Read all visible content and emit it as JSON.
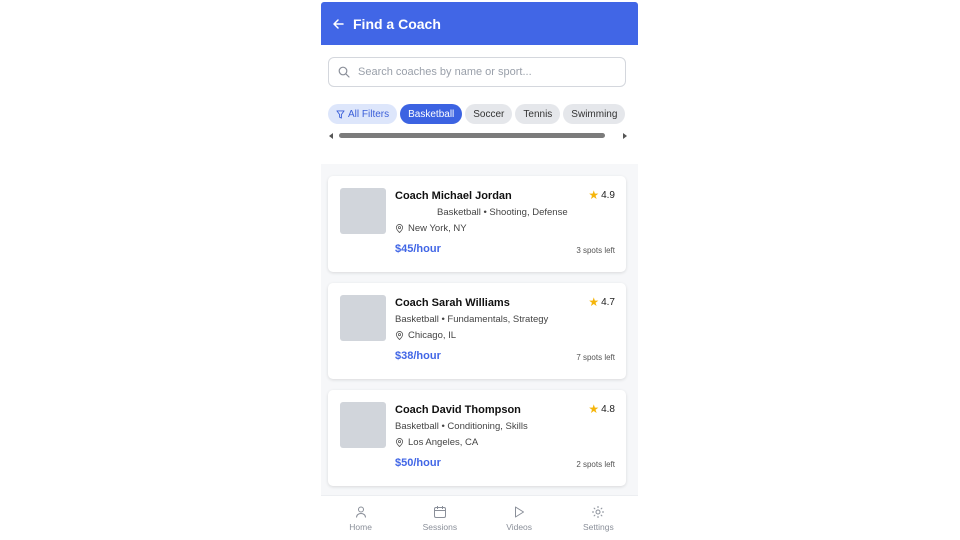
{
  "header": {
    "title": "Find a Coach",
    "back_icon": "arrow-left-icon"
  },
  "search": {
    "placeholder": "Search coaches by name or sport..."
  },
  "filters": {
    "all_filters_label": "All Filters",
    "chips": [
      "Basketball",
      "Soccer",
      "Tennis",
      "Swimming"
    ],
    "active": "Basketball"
  },
  "coaches": [
    {
      "name": "Coach Michael Jordan",
      "rating": "4.9",
      "meta": "Basketball • Shooting, Defense",
      "location": "New York, NY",
      "price": "$45/hour",
      "spots": "3 spots left"
    },
    {
      "name": "Coach Sarah Williams",
      "rating": "4.7",
      "meta": "Basketball • Fundamentals, Strategy",
      "location": "Chicago, IL",
      "price": "$38/hour",
      "spots": "7 spots left"
    },
    {
      "name": "Coach David Thompson",
      "rating": "4.8",
      "meta": "Basketball • Conditioning, Skills",
      "location": "Los Angeles, CA",
      "price": "$50/hour",
      "spots": "2 spots left"
    }
  ],
  "nav": [
    {
      "label": "Home",
      "icon": "user-icon"
    },
    {
      "label": "Sessions",
      "icon": "calendar-icon"
    },
    {
      "label": "Videos",
      "icon": "play-icon"
    },
    {
      "label": "Settings",
      "icon": "gear-icon"
    }
  ],
  "colors": {
    "primary": "#4166e6",
    "star": "#f5b50a",
    "chip_bg": "#e5e7eb"
  }
}
